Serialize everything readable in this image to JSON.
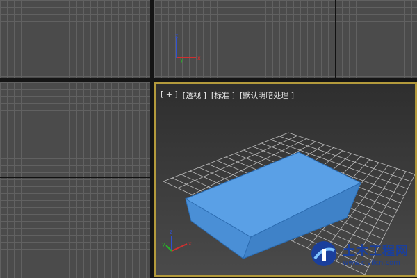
{
  "viewports": {
    "perspective": {
      "label_items": [
        "[ + ]",
        "[透视 ]",
        "[标准 ]",
        "[默认明暗处理 ]"
      ]
    }
  },
  "axis_gizmo": {
    "x": "x",
    "y": "y",
    "z": "z"
  },
  "colors": {
    "viewport_bg": "#4b4b4b",
    "grid_line": "#616161",
    "active_border": "#b39a3c",
    "box_fill": "#4a8fd6",
    "axis_x": "#d03030",
    "axis_y": "#28b028",
    "axis_z": "#3050d0"
  },
  "watermark": {
    "title": "土木工程网",
    "url": "www.civilcn.com"
  }
}
